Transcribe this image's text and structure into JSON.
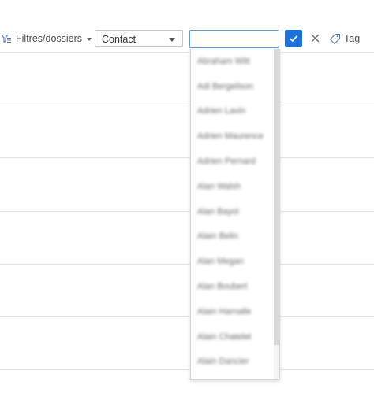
{
  "toolbar": {
    "filters_label": "Filtres/dossiers",
    "field_select": "Contact",
    "search_value": "",
    "tag_label": "Tag"
  },
  "dropdown": {
    "items": [
      "Abraham Witt",
      "Adi Bergeilson",
      "Adrien Lavin",
      "Adrien Maurence",
      "Adrien Pernard",
      "Alan Walsh",
      "Alan Bayol",
      "Alain Belin",
      "Alan Megan",
      "Alan Boubert",
      "Alain Harnalle",
      "Alain Chatelet",
      "Alain Dancier"
    ]
  },
  "colors": {
    "accent": "#1f73d8",
    "focus_border": "#5b9bd5",
    "divider": "#e4e4e4"
  },
  "icons": {
    "filters": "funnel-icon",
    "confirm": "check-icon",
    "cancel": "close-icon",
    "tag": "tag-icon"
  }
}
